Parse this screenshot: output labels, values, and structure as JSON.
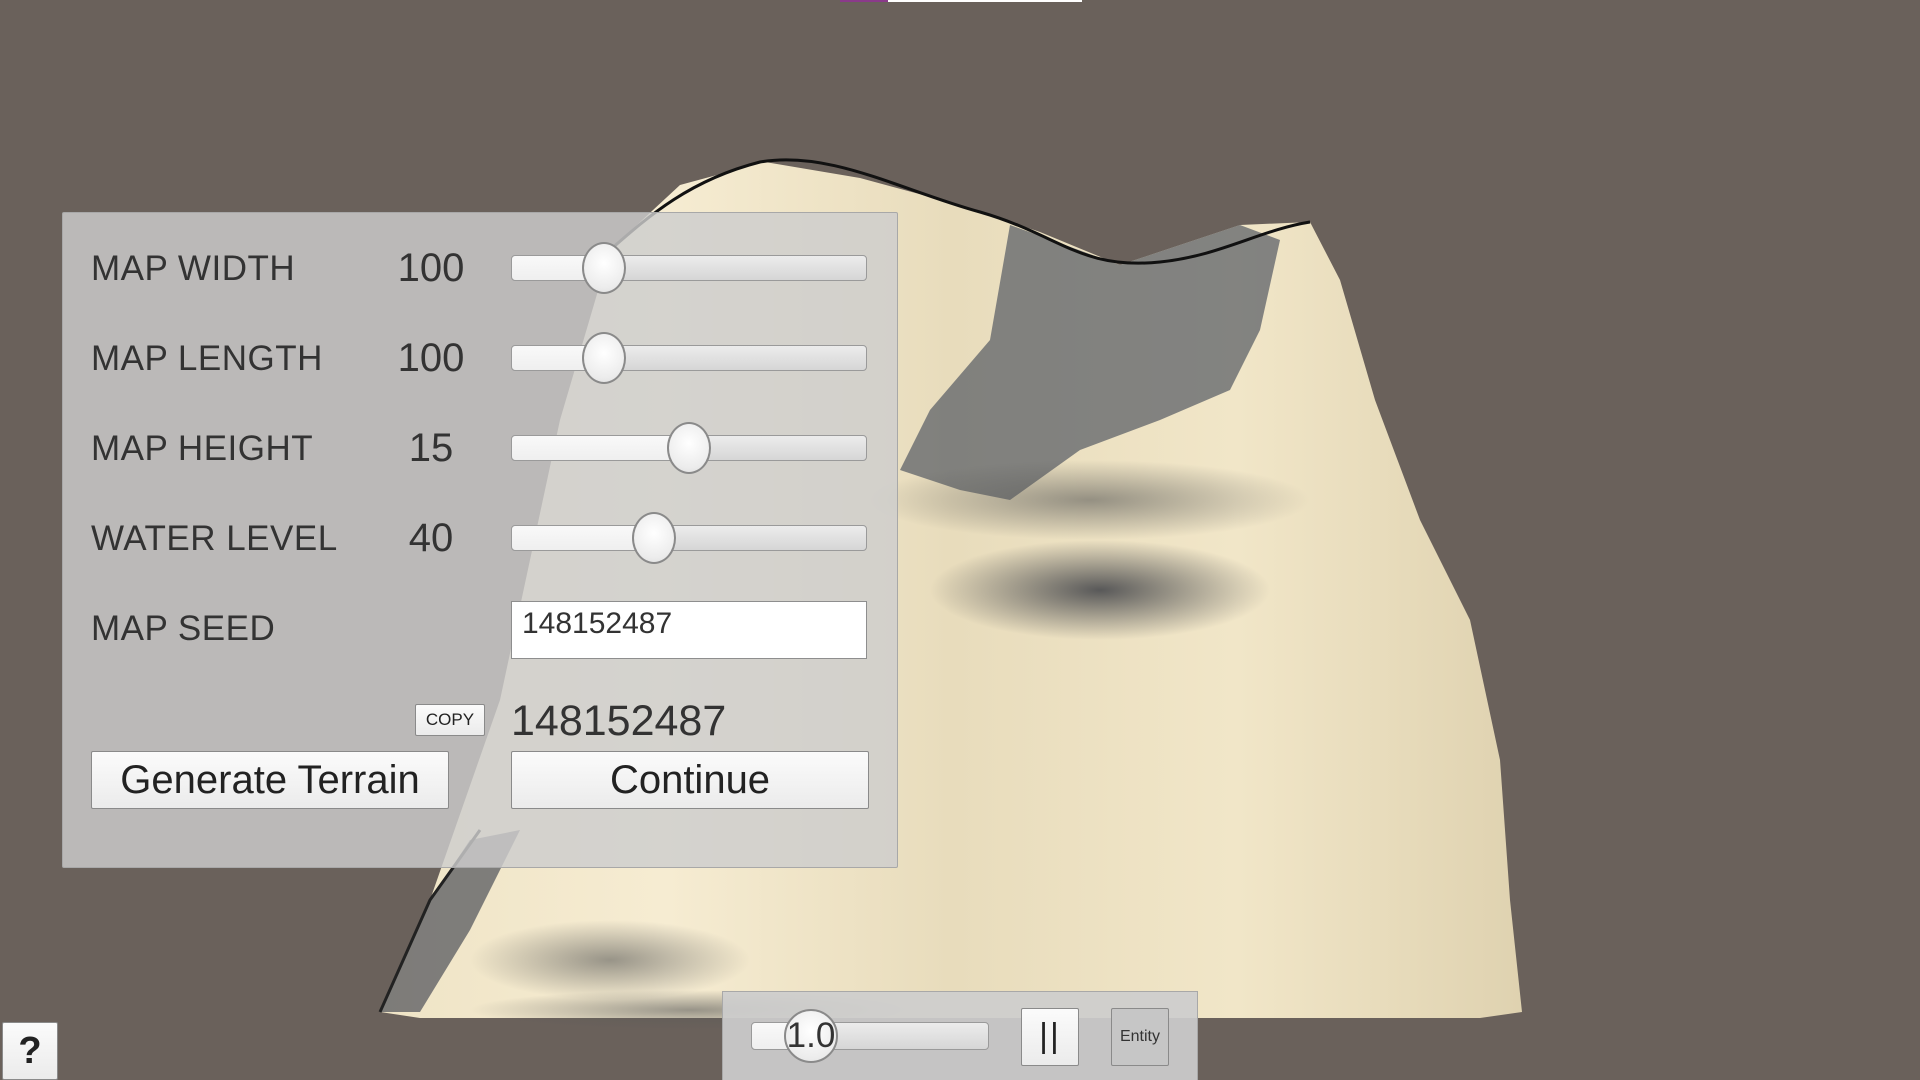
{
  "settings": {
    "map_width": {
      "label": "MAP WIDTH",
      "value": "100",
      "fraction": 0.26
    },
    "map_length": {
      "label": "MAP LENGTH",
      "value": "100",
      "fraction": 0.26
    },
    "map_height": {
      "label": "MAP HEIGHT",
      "value": "15",
      "fraction": 0.5
    },
    "water_level": {
      "label": "WATER LEVEL",
      "value": "40",
      "fraction": 0.4
    },
    "map_seed": {
      "label": "MAP SEED",
      "input_value": "148152487"
    },
    "copy_label": "COPY",
    "current_seed": "148152487",
    "generate_label": "Generate Terrain",
    "continue_label": "Continue"
  },
  "bottom_bar": {
    "speed_value": "1.0",
    "speed_fraction": 0.25,
    "pause_label": "||",
    "entity_label": "Entity"
  },
  "help_label": "?",
  "colors": {
    "background": "#6a615b",
    "terrain_light": "#f3e8cb",
    "terrain_shadow": "#5d6168"
  }
}
